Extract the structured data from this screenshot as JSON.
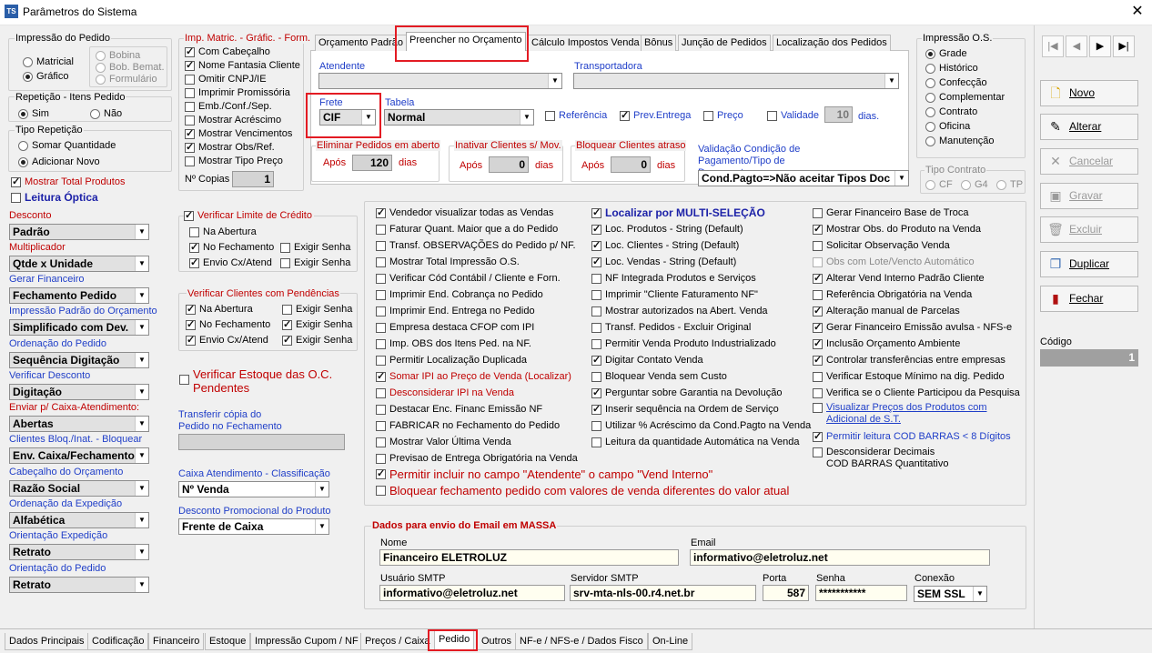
{
  "window": {
    "title": "Parâmetros do Sistema",
    "close": "✕",
    "logo": "TS"
  },
  "impressao_pedido": {
    "title": "Impressão do Pedido",
    "matricial": "Matricial",
    "grafico": "Gráfico",
    "bobina": "Bobina",
    "bob_bemat": "Bob. Bemat.",
    "formulario": "Formulário"
  },
  "repeticao": {
    "title": "Repetição - Itens Pedido",
    "sim": "Sim",
    "nao": "Não"
  },
  "tipo_repeticao": {
    "title": "Tipo Repetição",
    "somar": "Somar Quantidade",
    "adicionar": "Adicionar Novo"
  },
  "mostrar_total": "Mostrar Total Produtos",
  "leitura_optica": "Leitura Óptica",
  "left_fields": [
    {
      "label": "Desconto",
      "value": "Padrão",
      "color": "red"
    },
    {
      "label": "Multiplicador",
      "value": "Qtde x Unidade",
      "color": "red"
    },
    {
      "label": "Gerar Financeiro",
      "value": "Fechamento Pedido",
      "color": "blue"
    },
    {
      "label": "Impressão Padrão do Orçamento",
      "value": "Simplificado com Dev.",
      "color": "blue"
    },
    {
      "label": "Ordenação do Pedido",
      "value": "Sequência Digitação",
      "color": "blue"
    },
    {
      "label": "Verificar Desconto",
      "value": "Digitação",
      "color": "blue"
    },
    {
      "label": "Enviar p/ Caixa-Atendimento:",
      "value": "Abertas",
      "color": "red"
    },
    {
      "label": "Clientes Bloq./Inat. - Bloquear",
      "value": "Env. Caixa/Fechamento",
      "color": "blue"
    },
    {
      "label": "Cabeçalho do Orçamento",
      "value": "Razão Social",
      "color": "blue"
    },
    {
      "label": "Ordenação da Expedição",
      "value": "Alfabética",
      "color": "blue"
    },
    {
      "label": "Orientação Expedição",
      "value": "Retrato",
      "color": "blue"
    },
    {
      "label": "Orientação do Pedido",
      "value": "Retrato",
      "color": "blue"
    }
  ],
  "imp_matric": {
    "title": "Imp. Matric. - Gráfic. - Form.",
    "items": [
      "Com Cabeçalho",
      "Nome Fantasia Cliente",
      "Omitir CNPJ/IE",
      "Imprimir Promissória",
      "Emb./Conf./Sep.",
      "Mostrar Acréscimo",
      "Mostrar Vencimentos",
      "Mostrar Obs/Ref.",
      "Mostrar Tipo Preço"
    ],
    "copias_label": "Nº Copias",
    "copias": "1"
  },
  "verificar_limite": {
    "title": "Verificar Limite de Crédito",
    "na_abertura": "Na Abertura",
    "no_fechamento": "No Fechamento",
    "envio": "Envio Cx/Atend",
    "exigir": "Exigir Senha"
  },
  "verificar_clientes": {
    "title": "Verificar Clientes com Pendências",
    "na_abertura": "Na Abertura",
    "no_fechamento": "No Fechamento",
    "envio": "Envio Cx/Atend",
    "exigir": "Exigir Senha"
  },
  "verificar_estoque": "Verificar Estoque das O.C. Pendentes",
  "transferir": "Transferir cópia do Pedido no Fechamento",
  "caixa_atendimento": {
    "label": "Caixa Atendimento - Classificação",
    "value": "Nº Venda"
  },
  "desconto_promocional": {
    "label": "Desconto Promocional do Produto",
    "value": "Frente de Caixa"
  },
  "tabs": [
    "Orçamento Padrão",
    "Preencher no Orçamento",
    "Cálculo Impostos Venda",
    "Bônus",
    "Junção de Pedidos",
    "Localização dos Pedidos"
  ],
  "preencher": {
    "atendente": "Atendente",
    "transportadora": "Transportadora",
    "frete": "Frete",
    "frete_value": "CIF",
    "tabela": "Tabela",
    "tabela_value": "Normal",
    "referencia": "Referência",
    "prev_entrega": "Prev.Entrega",
    "preco": "Preço",
    "validade": "Validade",
    "validade_value": "10",
    "dias": "dias."
  },
  "eliminar": {
    "title": "Eliminar Pedidos em aberto",
    "apos": "Após",
    "value": "120",
    "dias": "dias"
  },
  "inativar": {
    "title": "Inativar Clientes s/ Mov.",
    "apos": "Após",
    "value": "0",
    "dias": "dias"
  },
  "bloquear": {
    "title": "Bloquear Clientes atraso",
    "apos": "Após",
    "value": "0",
    "dias": "dias"
  },
  "validacao": {
    "label": "Validação Condição de Pagamento/Tipo de Documento",
    "value": "Cond.Pagto=>Não aceitar Tipos Doc"
  },
  "impressao_os": {
    "title": "Impressão O.S.",
    "items": [
      "Grade",
      "Histórico",
      "Confecção",
      "Complementar",
      "Contrato",
      "Oficina",
      "Manutenção"
    ]
  },
  "tipo_contrato": {
    "title": "Tipo Contrato",
    "items": [
      "CF",
      "G4",
      "TP"
    ]
  },
  "col1": [
    {
      "t": "Vendedor visualizar todas as Vendas",
      "c": true
    },
    {
      "t": "Faturar Quant. Maior que a do Pedido",
      "c": false
    },
    {
      "t": "Transf. OBSERVAÇÕES do Pedido p/ NF.",
      "c": false
    },
    {
      "t": "Mostrar Total Impressão O.S.",
      "c": false
    },
    {
      "t": "Verificar Cód Contábil / Cliente e Forn.",
      "c": false
    },
    {
      "t": "Imprimir End. Cobrança no Pedido",
      "c": false
    },
    {
      "t": "Imprimir End. Entrega no Pedido",
      "c": false
    },
    {
      "t": "Empresa destaca CFOP com IPI",
      "c": false
    },
    {
      "t": "Imp. OBS dos Itens Ped. na NF.",
      "c": false
    },
    {
      "t": "Permitir Localização Duplicada",
      "c": false
    },
    {
      "t": "Somar IPI ao Preço de Venda (Localizar)",
      "c": true,
      "red": true
    },
    {
      "t": "Desconsiderar IPI na Venda",
      "c": false,
      "red": true
    },
    {
      "t": "Destacar Enc. Financ Emissão NF",
      "c": false
    },
    {
      "t": "FABRICAR no Fechamento do Pedido",
      "c": false
    },
    {
      "t": "Mostrar Valor Última Venda",
      "c": false
    },
    {
      "t": "Previsao de Entrega Obrigatória na Venda",
      "c": false
    }
  ],
  "col2": [
    {
      "t": "Localizar por MULTI-SELEÇÃO",
      "c": true,
      "bold": true
    },
    {
      "t": "Loc. Produtos - String (Default)",
      "c": true
    },
    {
      "t": "Loc. Clientes - String (Default)",
      "c": true
    },
    {
      "t": "Loc. Vendas - String (Default)",
      "c": true
    },
    {
      "t": "NF Integrada Produtos e Serviços",
      "c": false
    },
    {
      "t": "Imprimir \"Cliente Faturamento NF\"",
      "c": false
    },
    {
      "t": "Mostrar autorizados na Abert. Venda",
      "c": false
    },
    {
      "t": "Transf. Pedidos - Excluir Original",
      "c": false
    },
    {
      "t": "Permitir Venda Produto Industrializado",
      "c": false
    },
    {
      "t": "Digitar Contato Venda",
      "c": true
    },
    {
      "t": "Bloquear Venda sem Custo",
      "c": false
    },
    {
      "t": "Perguntar sobre Garantia na Devolução",
      "c": true
    },
    {
      "t": "Inserir sequência na Ordem de Serviço",
      "c": true
    },
    {
      "t": "Utilizar % Acréscimo da Cond.Pagto na Venda",
      "c": false
    },
    {
      "t": "Leitura da quantidade Automática na Venda",
      "c": false
    }
  ],
  "col3": [
    {
      "t": "Gerar Financeiro Base de Troca",
      "c": false
    },
    {
      "t": "Mostrar Obs. do Produto na Venda",
      "c": true
    },
    {
      "t": "Solicitar Observação Venda",
      "c": false
    },
    {
      "t": "Obs com Lote/Vencto Automático",
      "c": false,
      "gray": true
    },
    {
      "t": "Alterar Vend Interno Padrão Cliente",
      "c": true
    },
    {
      "t": "Referência Obrigatória na Venda",
      "c": false
    },
    {
      "t": "Alteração manual de Parcelas",
      "c": true
    },
    {
      "t": "Gerar Financeiro Emissão avulsa - NFS-e",
      "c": true
    },
    {
      "t": "Inclusão Orçamento Ambiente",
      "c": true
    },
    {
      "t": "Controlar transferências entre empresas",
      "c": true
    },
    {
      "t": "Verificar Estoque Mínimo na dig. Pedido",
      "c": false
    },
    {
      "t": "Verifica se o Cliente Participou da Pesquisa",
      "c": false
    }
  ],
  "col3_extra": {
    "visualizar": "Visualizar Preços dos Produtos com Adicional de S.T.",
    "permitir_leitura": "Permitir leitura COD BARRAS < 8 Dígitos",
    "desconsiderar": "Desconsiderar Decimais COD BARRAS Quantitativo"
  },
  "wide1": "Permitir incluir no campo \"Atendente\" o campo \"Vend Interno\"",
  "wide2": "Bloquear fechamento pedido com valores de venda diferentes do valor atual",
  "email": {
    "title": "Dados para envio do Email em MASSA",
    "nome_label": "Nome",
    "nome": "Financeiro ELETROLUZ",
    "email_label": "Email",
    "email": "informativo@eletroluz.net",
    "usuario_label": "Usuário SMTP",
    "usuario": "informativo@eletroluz.net",
    "servidor_label": "Servidor SMTP",
    "servidor": "srv-mta-nls-00.r4.net.br",
    "porta_label": "Porta",
    "porta": "587",
    "senha_label": "Senha",
    "senha": "***********",
    "conexao_label": "Conexão",
    "conexao": "SEM SSL"
  },
  "side_buttons": {
    "novo": "Novo",
    "alterar": "Alterar",
    "cancelar": "Cancelar",
    "gravar": "Gravar",
    "excluir": "Excluir",
    "duplicar": "Duplicar",
    "fechar": "Fechar"
  },
  "nav": [
    "|◀",
    "◀",
    "▶",
    "▶|"
  ],
  "codigo": {
    "label": "Código",
    "value": "1"
  },
  "bottom_tabs": [
    "Dados Principais",
    "Codificação",
    "Financeiro",
    "Estoque",
    "Impressão Cupom / NF",
    "Preços / Caixa",
    "Pedido",
    "Outros",
    "NF-e / NFS-e / Dados Fisco",
    "On-Line"
  ]
}
